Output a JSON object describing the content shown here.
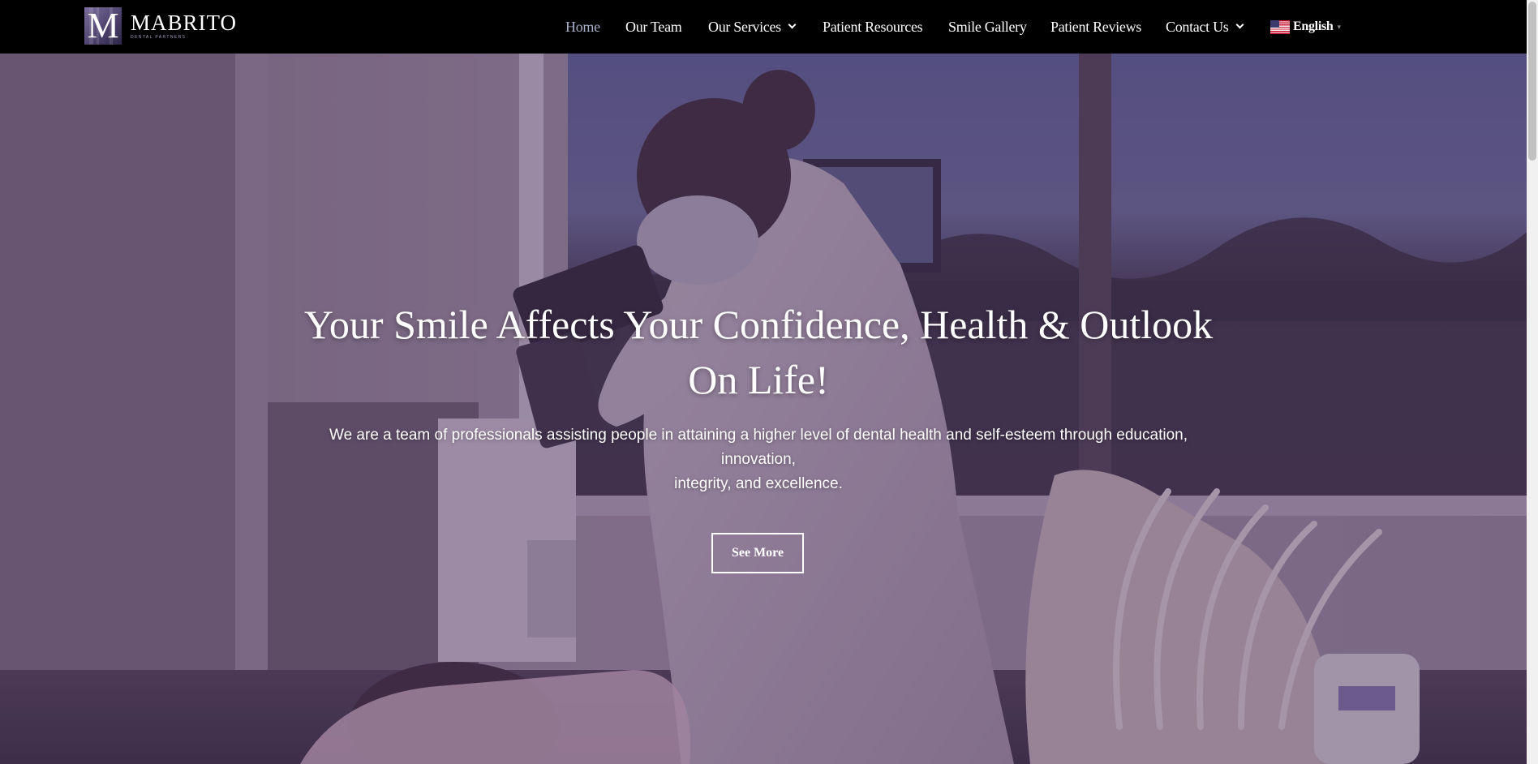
{
  "header": {
    "logo": {
      "mark_letter": "M",
      "name": "MABRITO",
      "tagline": "DENTAL PARTNERS"
    },
    "nav": {
      "items": [
        {
          "label": "Home",
          "active": true,
          "has_dropdown": false
        },
        {
          "label": "Our Team",
          "active": false,
          "has_dropdown": false
        },
        {
          "label": "Our Services",
          "active": false,
          "has_dropdown": true
        },
        {
          "label": "Patient Resources",
          "active": false,
          "has_dropdown": false
        },
        {
          "label": "Smile Gallery",
          "active": false,
          "has_dropdown": false
        },
        {
          "label": "Patient Reviews",
          "active": false,
          "has_dropdown": false
        },
        {
          "label": "Contact Us",
          "active": false,
          "has_dropdown": true
        }
      ],
      "language": {
        "label": "English",
        "flag_icon": "us-flag-icon"
      }
    }
  },
  "hero": {
    "title_line1": "Your Smile Affects Your Confidence, Health & Outlook",
    "title_line2": "On Life!",
    "subtitle_line1": "We are a team of professionals assisting people in attaining a higher level of dental health and self-esteem through education, innovation,",
    "subtitle_line2": "integrity, and excellence.",
    "cta_label": "See More"
  },
  "colors": {
    "header_bg": "#000000",
    "nav_text": "#ffffff",
    "nav_active": "#aab0cc",
    "hero_overlay": "#462d5f",
    "logo_accent": "#7b6e9c"
  }
}
